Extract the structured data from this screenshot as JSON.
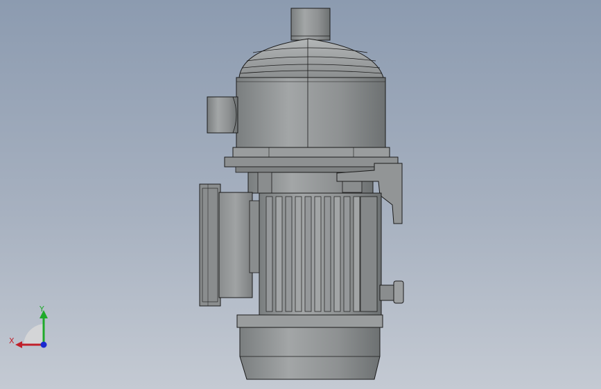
{
  "viewport": {
    "background_top": "#8c9bb0",
    "background_bottom": "#c4cad3"
  },
  "model": {
    "body_color": "#8d9091",
    "body_light": "#a9acad",
    "body_dark": "#6e7273",
    "edge_color": "#1a1a1a"
  },
  "triad": {
    "x_label": "X",
    "y_label": "Y",
    "x_color": "#c0202a",
    "y_color": "#1faa2a",
    "z_color": "#1a2ad0"
  }
}
